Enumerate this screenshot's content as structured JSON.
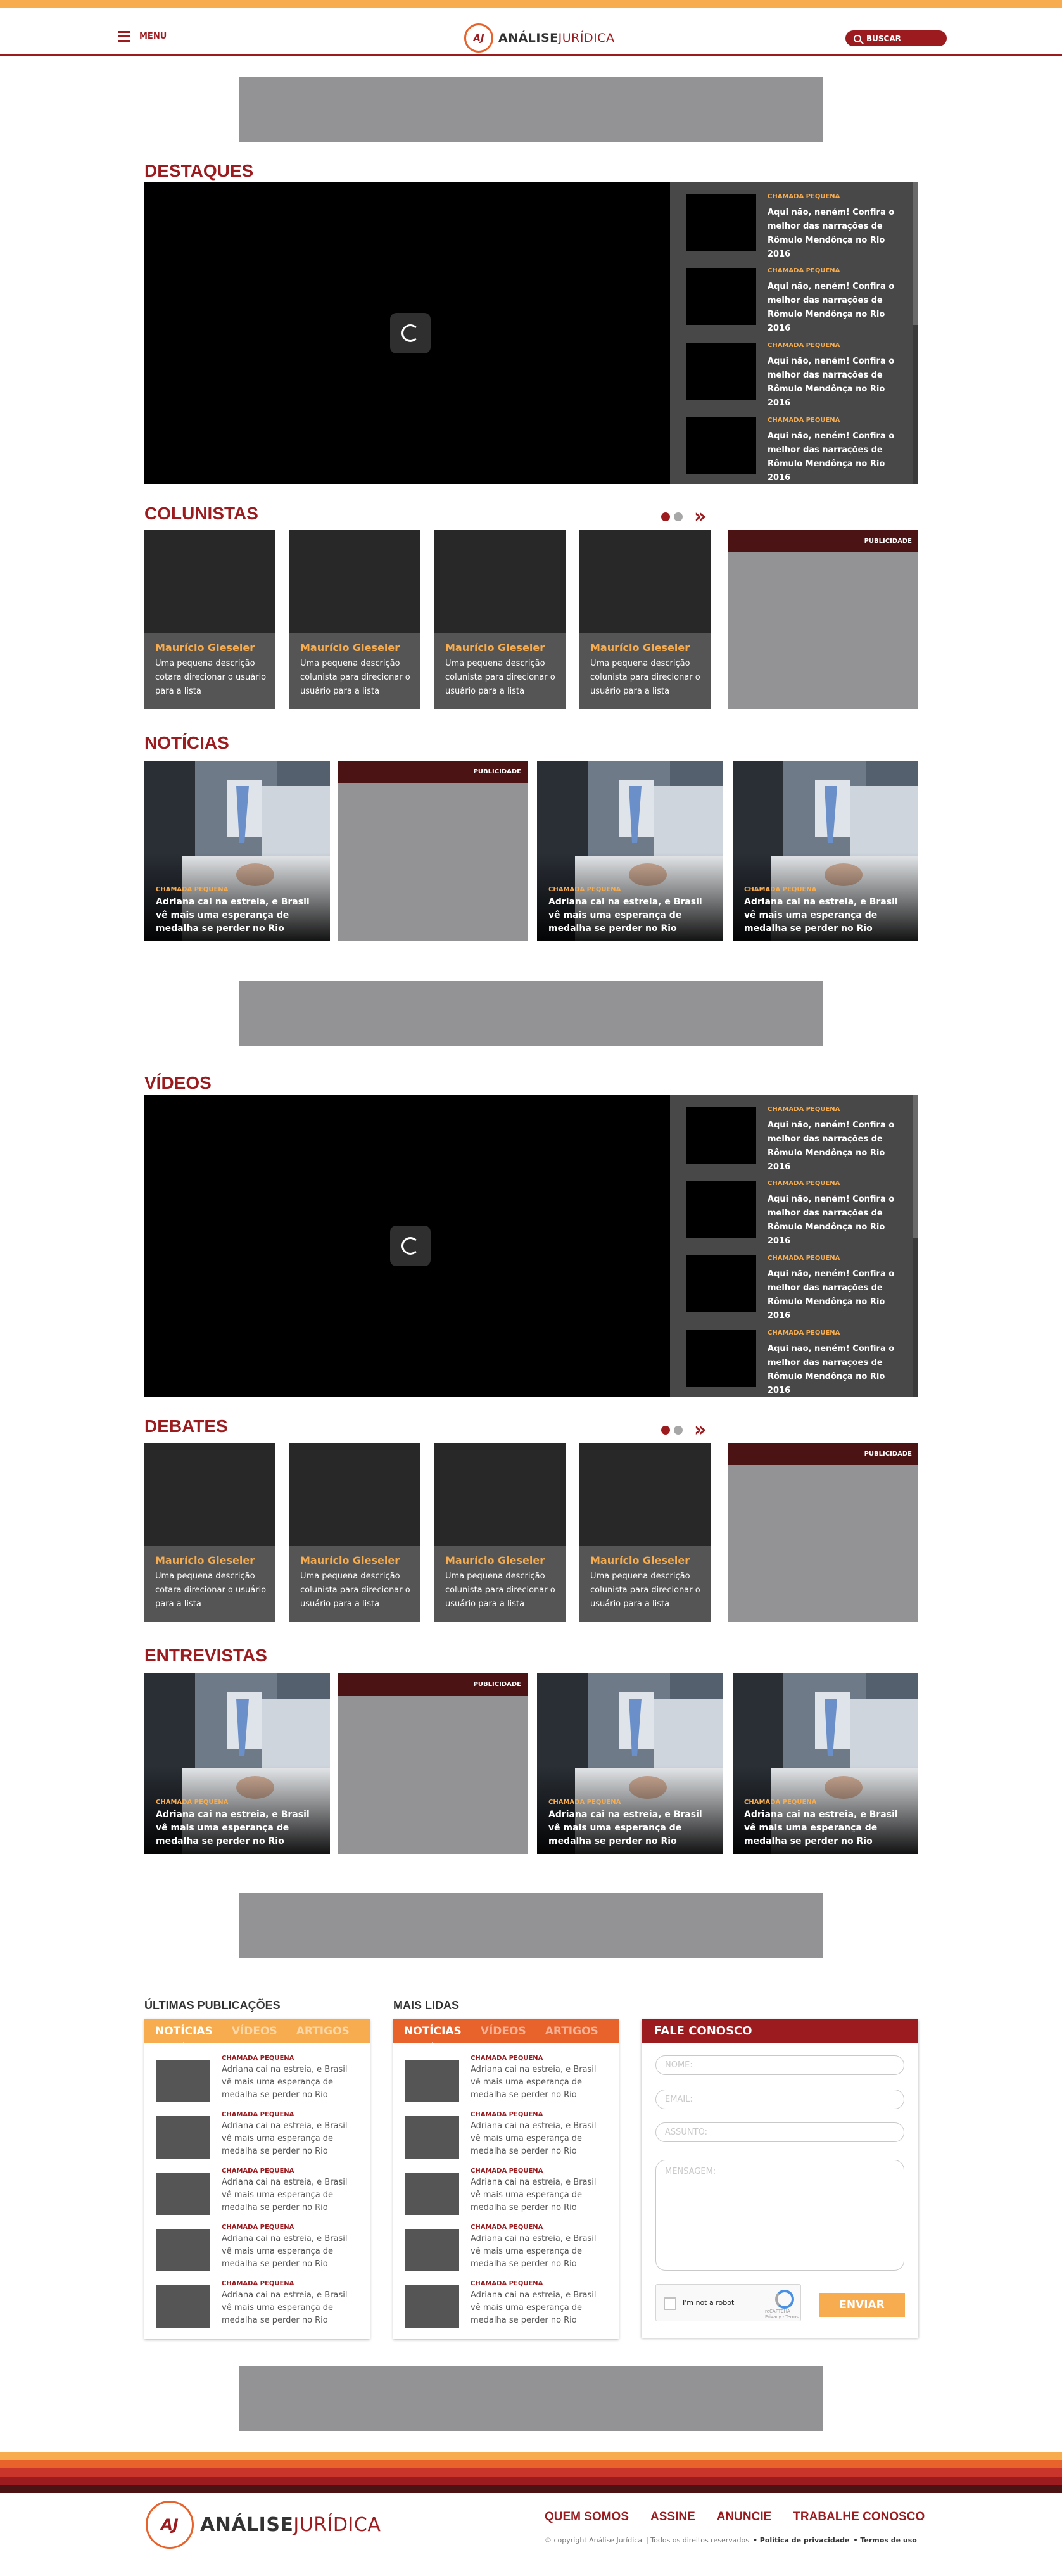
{
  "header": {
    "menu_label": "MENU",
    "logo_main": "ANÁLISE",
    "logo_accent": "JURÍDICA",
    "logo_mark": "AJ",
    "search_label": "BUSCAR"
  },
  "colors": {
    "primary": "#9b1b1f",
    "accent": "#f6ac4f",
    "orange": "#e8622b",
    "ad_gray": "#939396"
  },
  "destaques": {
    "title": "DESTAQUES",
    "items": [
      {
        "tag": "CHAMADA PEQUENA",
        "text": "Aqui não, neném! Confira o melhor das narrações de Rômulo Mendônça no Rio 2016"
      },
      {
        "tag": "CHAMADA PEQUENA",
        "text": "Aqui não, neném! Confira o melhor das narrações de Rômulo Mendônça no Rio 2016"
      },
      {
        "tag": "CHAMADA PEQUENA",
        "text": "Aqui não, neném! Confira o melhor das narrações de Rômulo Mendônça no Rio 2016"
      },
      {
        "tag": "CHAMADA PEQUENA",
        "text": "Aqui não, neném! Confira o melhor das narrações de Rômulo Mendônça no Rio 2016"
      }
    ]
  },
  "colunistas": {
    "title": "COLUNISTAS",
    "pub_label": "PUBLICIDADE",
    "cards": [
      {
        "name": "Maurício Gieseler",
        "desc": "Uma pequena descrição cotara direcionar o usuário para a lista"
      },
      {
        "name": "Maurício Gieseler",
        "desc": "Uma pequena descrição colunista para direcionar o usuário para a lista"
      },
      {
        "name": "Maurício Gieseler",
        "desc": "Uma pequena descrição colunista para direcionar o usuário para a lista"
      },
      {
        "name": "Maurício Gieseler",
        "desc": "Uma pequena descrição colunista para direcionar o usuário para a lista"
      }
    ]
  },
  "noticias": {
    "title": "NOTÍCIAS",
    "pub_label": "PUBLICIDADE",
    "cards": [
      {
        "tag": "CHAMADA PEQUENA",
        "text": "Adriana cai na estreia, e Brasil vê mais uma esperança de medalha se perder no Rio"
      },
      {
        "tag": "CHAMADA PEQUENA",
        "text": "Adriana cai na estreia, e Brasil vê mais uma esperança de medalha se perder no Rio"
      },
      {
        "tag": "CHAMADA PEQUENA",
        "text": "Adriana cai na estreia, e Brasil vê mais uma esperança de medalha se perder no Rio"
      }
    ]
  },
  "videos": {
    "title": "VÍDEOS",
    "items": [
      {
        "tag": "CHAMADA PEQUENA",
        "text": "Aqui não, neném! Confira o melhor das narrações de Rômulo Mendônça no Rio 2016"
      },
      {
        "tag": "CHAMADA PEQUENA",
        "text": "Aqui não, neném! Confira o melhor das narrações de Rômulo Mendônça no Rio 2016"
      },
      {
        "tag": "CHAMADA PEQUENA",
        "text": "Aqui não, neném! Confira o melhor das narrações de Rômulo Mendônça no Rio 2016"
      },
      {
        "tag": "CHAMADA PEQUENA",
        "text": "Aqui não, neném! Confira o melhor das narrações de Rômulo Mendônça no Rio 2016"
      }
    ]
  },
  "debates": {
    "title": "DEBATES",
    "pub_label": "PUBLICIDADE",
    "cards": [
      {
        "name": "Maurício Gieseler",
        "desc": "Uma pequena descrição cotara direcionar o usuário para a lista"
      },
      {
        "name": "Maurício Gieseler",
        "desc": "Uma pequena descrição colunista para direcionar o usuário para a lista"
      },
      {
        "name": "Maurício Gieseler",
        "desc": "Uma pequena descrição colunista para direcionar o usuário para a lista"
      },
      {
        "name": "Maurício Gieseler",
        "desc": "Uma pequena descrição colunista para direcionar o usuário para a lista"
      }
    ]
  },
  "entrevistas": {
    "title": "ENTREVISTAS",
    "pub_label": "PUBLICIDADE",
    "cards": [
      {
        "tag": "CHAMADA PEQUENA",
        "text": "Adriana cai na estreia, e Brasil vê mais uma esperança de medalha se perder no Rio"
      },
      {
        "tag": "CHAMADA PEQUENA",
        "text": "Adriana cai na estreia, e Brasil vê mais uma esperança de medalha se perder no Rio"
      },
      {
        "tag": "CHAMADA PEQUENA",
        "text": "Adriana cai na estreia, e Brasil vê mais uma esperança de medalha se perder no Rio"
      }
    ]
  },
  "ultimas": {
    "title": "ÚLTIMAS PUBLICAÇÕES",
    "tabs": [
      "NOTÍCIAS",
      "VÍDEOS",
      "ARTIGOS"
    ],
    "items": [
      {
        "tag": "CHAMADA PEQUENA",
        "text": "Adriana cai na estreia, e Brasil vê mais uma esperança de medalha se perder no Rio"
      },
      {
        "tag": "CHAMADA PEQUENA",
        "text": "Adriana cai na estreia, e Brasil vê mais uma esperança de medalha se perder no Rio"
      },
      {
        "tag": "CHAMADA PEQUENA",
        "text": "Adriana cai na estreia, e Brasil vê mais uma esperança de medalha se perder no Rio"
      },
      {
        "tag": "CHAMADA PEQUENA",
        "text": "Adriana cai na estreia, e Brasil vê mais uma esperança de medalha se perder no Rio"
      },
      {
        "tag": "CHAMADA PEQUENA",
        "text": "Adriana cai na estreia, e Brasil vê mais uma esperança de medalha se perder no Rio"
      }
    ]
  },
  "mais_lidas": {
    "title": "MAIS LIDAS",
    "tabs": [
      "NOTÍCIAS",
      "VÍDEOS",
      "ARTIGOS"
    ],
    "items": [
      {
        "tag": "CHAMADA PEQUENA",
        "text": "Adriana cai na estreia, e Brasil vê mais uma esperança de medalha se perder no Rio"
      },
      {
        "tag": "CHAMADA PEQUENA",
        "text": "Adriana cai na estreia, e Brasil vê mais uma esperança de medalha se perder no Rio"
      },
      {
        "tag": "CHAMADA PEQUENA",
        "text": "Adriana cai na estreia, e Brasil vê mais uma esperança de medalha se perder no Rio"
      },
      {
        "tag": "CHAMADA PEQUENA",
        "text": "Adriana cai na estreia, e Brasil vê mais uma esperança de medalha se perder no Rio"
      },
      {
        "tag": "CHAMADA PEQUENA",
        "text": "Adriana cai na estreia, e Brasil vê mais uma esperança de medalha se perder no Rio"
      }
    ]
  },
  "contato": {
    "title": "FALE CONOSCO",
    "name_placeholder": "NOME:",
    "email_placeholder": "EMAIL:",
    "subject_placeholder": "ASSUNTO:",
    "message_placeholder": "MENSAGEM:",
    "captcha_label": "I'm not a robot",
    "captcha_brand": "reCAPTCHA",
    "captcha_terms": "Privacy - Terms",
    "send_label": "ENVIAR"
  },
  "footer": {
    "nav": [
      "QUEM SOMOS",
      "ASSINE",
      "ANUNCIE",
      "TRABALHE CONOSCO"
    ],
    "copyright": "© copyright Análise Jurídica",
    "rights": "| Todos os direitos reservados",
    "privacy": "• Política de privacidade",
    "terms": "• Termos de uso",
    "stripes": [
      "#f6ac4f",
      "#e8622b",
      "#c9352a",
      "#9b1b1f",
      "#4b1313"
    ]
  }
}
